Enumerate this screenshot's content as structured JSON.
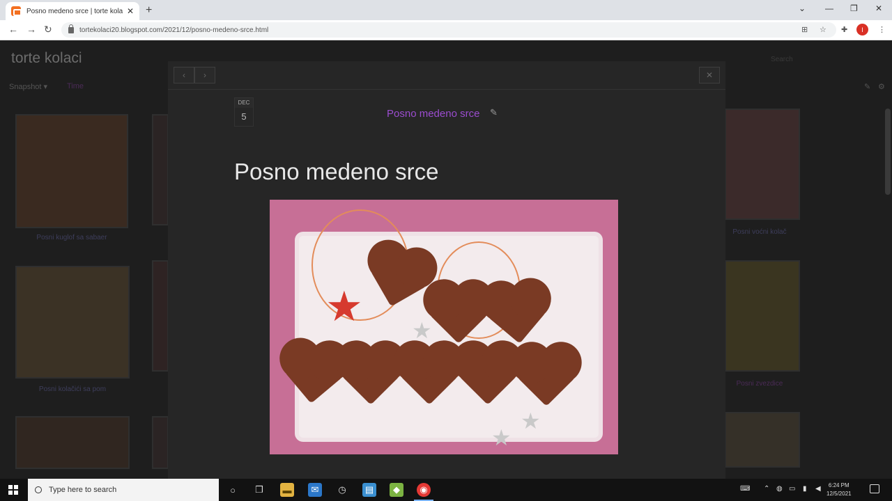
{
  "browser": {
    "tab_title": "Posno medeno srce | torte kolaci",
    "tab_close": "✕",
    "new_tab": "+",
    "url": "tortekolaci20.blogspot.com/2021/12/posno-medeno-srce.html",
    "profile_initial": "I"
  },
  "blog": {
    "title": "torte kolaci",
    "view_select": "Snapshot ▾",
    "view_current": "Time",
    "search": "Search",
    "captions": [
      "Posni kuglof sa sabaer",
      "Posni kolačići sa pom",
      "Posni voćni kolač",
      "Posni zvezdice"
    ]
  },
  "modal": {
    "prev": "‹",
    "next": "›",
    "close": "✕",
    "date_month": "DEC",
    "date_day": "5",
    "post_link": "Posno medeno srce",
    "post_title": "Posno medeno srce"
  },
  "taskbar": {
    "search_placeholder": "Type here to search",
    "time": "6:24 PM",
    "date": "12/5/2021"
  },
  "icons": {
    "pencil": "✎",
    "star": "★"
  }
}
